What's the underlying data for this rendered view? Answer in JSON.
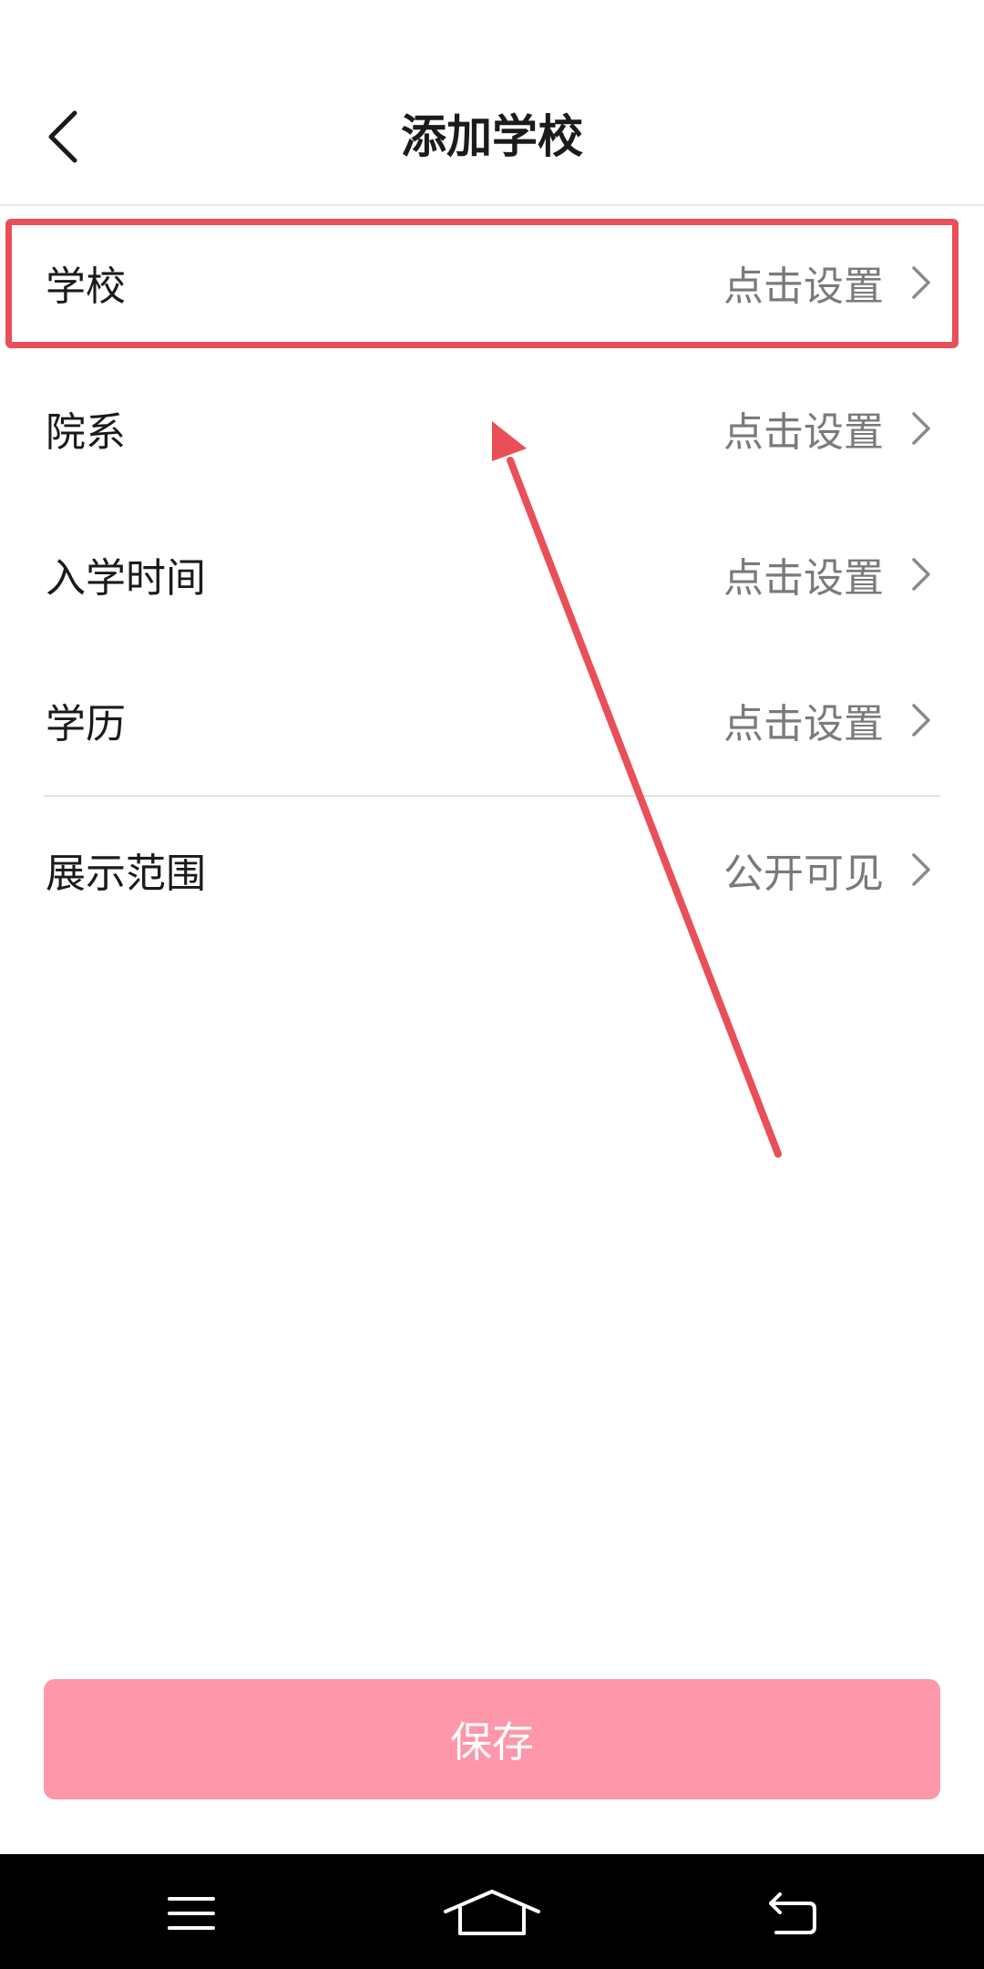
{
  "header": {
    "title": "添加学校"
  },
  "rows": [
    {
      "label": "学校",
      "value": "点击设置"
    },
    {
      "label": "院系",
      "value": "点击设置"
    },
    {
      "label": "入学时间",
      "value": "点击设置"
    },
    {
      "label": "学历",
      "value": "点击设置"
    },
    {
      "label": "展示范围",
      "value": "公开可见"
    }
  ],
  "save_button": {
    "label": "保存"
  },
  "colors": {
    "accent": "#fe97a9",
    "highlight": "#e94f57",
    "navbar": "#000000"
  },
  "icons": {
    "back": "chevron-left-icon",
    "row": "chevron-right-icon",
    "nav_menu": "menu-icon",
    "nav_home": "home-icon",
    "nav_back": "back-icon"
  }
}
